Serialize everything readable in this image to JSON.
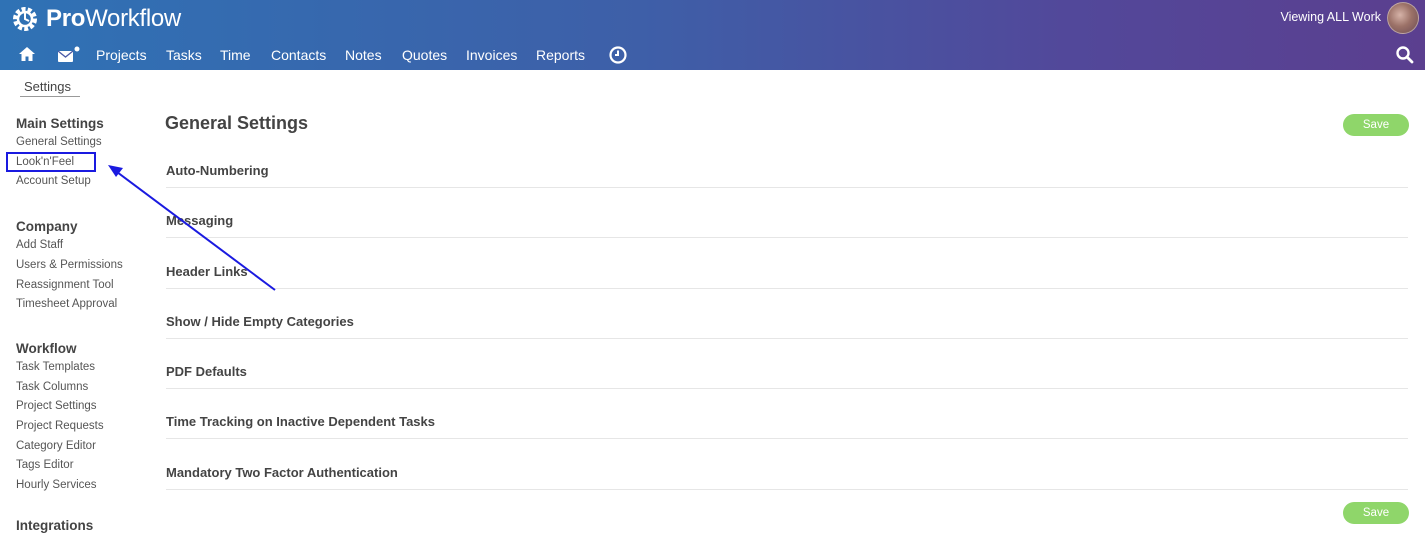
{
  "app": {
    "logo_bold": "Pro",
    "logo_rest": "Workflow",
    "viewing_label": "Viewing ALL Work"
  },
  "nav": {
    "items": [
      "Projects",
      "Tasks",
      "Time",
      "Contacts",
      "Notes",
      "Quotes",
      "Invoices",
      "Reports"
    ],
    "icons": [
      "home-icon",
      "mail-icon",
      "clock-icon",
      "search-icon"
    ]
  },
  "breadcrumb": "Settings",
  "sidebar": {
    "main": {
      "heading": "Main Settings",
      "items": [
        "General Settings",
        "Look'n'Feel",
        "Account Setup"
      ]
    },
    "company": {
      "heading": "Company",
      "items": [
        "Add Staff",
        "Users & Permissions",
        "Reassignment Tool",
        "Timesheet Approval"
      ]
    },
    "workflow": {
      "heading": "Workflow",
      "items": [
        "Task Templates",
        "Task Columns",
        "Project Settings",
        "Project Requests",
        "Category Editor",
        "Tags Editor",
        "Hourly Services"
      ]
    },
    "integrations": {
      "heading": "Integrations"
    }
  },
  "main": {
    "title": "General Settings",
    "save_label": "Save",
    "sections": [
      "Auto-Numbering",
      "Messaging",
      "Header Links",
      "Show / Hide Empty Categories",
      "PDF Defaults",
      "Time Tracking on Inactive Dependent Tasks",
      "Mandatory Two Factor Authentication"
    ]
  },
  "colors": {
    "accent_green": "#8fd66a",
    "highlight_blue": "#1a1ae0"
  }
}
